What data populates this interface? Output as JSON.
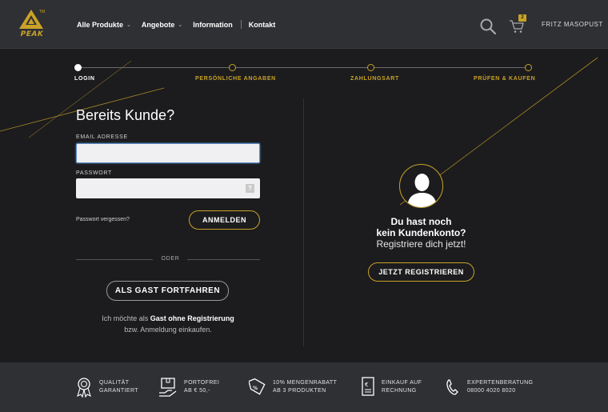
{
  "header": {
    "brand": "PEAK",
    "trademark": "TM",
    "nav": [
      {
        "label": "Alle Produkte",
        "has_dropdown": true
      },
      {
        "label": "Angebote",
        "has_dropdown": true
      },
      {
        "label": "Information",
        "has_dropdown": false
      },
      {
        "label": "Kontakt",
        "has_dropdown": false
      }
    ],
    "cart_count": "2",
    "user_name": "FRITZ MASOPUST"
  },
  "steps": [
    {
      "label": "LOGIN",
      "active": true
    },
    {
      "label": "PERSÖNLICHE ANGABEN",
      "active": false
    },
    {
      "label": "ZAHLUNGSART",
      "active": false
    },
    {
      "label": "PRÜFEN & KAUFEN",
      "active": false
    }
  ],
  "login": {
    "title": "Bereits Kunde?",
    "email_label": "EMAIL ADRESSE",
    "email_value": "",
    "password_label": "PASSWORT",
    "password_value": "",
    "password_icon": "?",
    "forgot_label": "Passwort vergessen?",
    "submit_label": "ANMELDEN",
    "or_label": "ODER",
    "guest_button": "ALS GAST FORTFAHREN",
    "guest_info_pre": "Ich möchte als ",
    "guest_info_bold": "Gast ohne Registrierung",
    "guest_info_post": "bzw. Anmeldung einkaufen."
  },
  "register": {
    "title_line1": "Du hast noch",
    "title_line2": "kein Kundenkonto?",
    "subtitle": "Registriere dich jetzt!",
    "button": "JETZT REGISTRIEREN"
  },
  "footer": {
    "usps": [
      {
        "icon": "medal-icon",
        "text": "QUALITÄT\nGARANTIERT"
      },
      {
        "icon": "box-hand-icon",
        "text": "PORTOFREI\nAB € 50,-"
      },
      {
        "icon": "discount-tag-icon",
        "text": "10% MENGENRABATT\nAB 3 PRODUKTEN"
      },
      {
        "icon": "invoice-icon",
        "text": "EINKAUF AUF\nRECHNUNG"
      },
      {
        "icon": "phone-icon",
        "text": "EXPERTENBERATUNG\n08000 4020 8020"
      }
    ]
  },
  "colors": {
    "accent": "#c9a227",
    "background": "#1c1c1e",
    "header": "#2f3034"
  }
}
